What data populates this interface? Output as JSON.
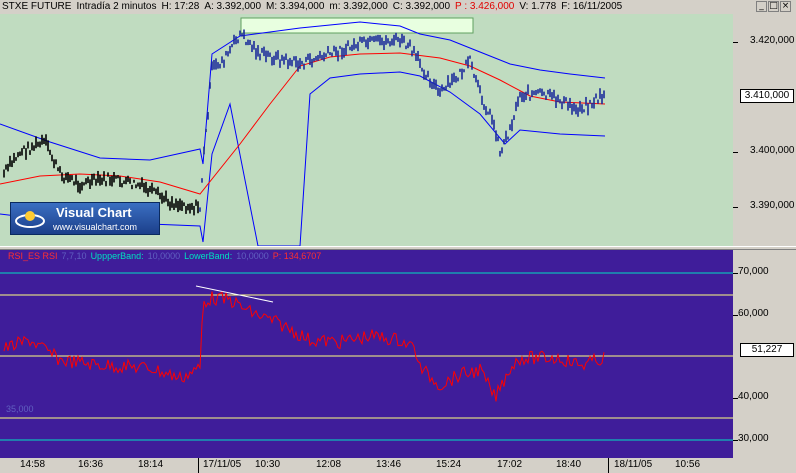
{
  "title_bar": {
    "symbol": "STXE FUTURE",
    "interval": "Intradía 2 minutos",
    "high": "H: 17:28",
    "ask": "A: 3.392,000",
    "max": "M: 3.394,000",
    "min": "m: 3.392,000",
    "close": "C: 3.392,000",
    "price": "P : 3.426,000",
    "volume": "V: 1.778",
    "date": "F: 16/11/2005",
    "min_btn": "_",
    "max_btn": "□",
    "close_btn": "×"
  },
  "price_axis": {
    "ticks": [
      "3.420,000",
      "3.410,000",
      "3.400,000",
      "3.390,000"
    ],
    "current": "3.410,000"
  },
  "logo": {
    "name": "Visual Chart",
    "url": "www.visualchart.com"
  },
  "rsi_header": {
    "name": "RSI_ES  RSI",
    "params": "7,7,10",
    "upper_label": "UppperBand:",
    "upper_value": "10,0000",
    "lower_label": "LowerBand:",
    "lower_value": "10,0000",
    "p_value": "P: 134,6707",
    "side_label": "35,000",
    "min_btn": "_",
    "max_btn": "□",
    "close_btn": "×"
  },
  "rsi_axis": {
    "ticks": [
      "70,000",
      "60,000",
      "40,000",
      "30,000"
    ],
    "current": "51,227"
  },
  "time_axis": {
    "labels": [
      "14:58",
      "16:36",
      "18:14",
      "17/11/05",
      "10:30",
      "12:08",
      "13:46",
      "15:24",
      "17:02",
      "18:40",
      "18/11/05",
      "10:56"
    ]
  },
  "colors": {
    "price_bg": "#c0dcc0",
    "rsi_bg": "#3f1d9a",
    "bands": "#0000ff",
    "ma": "#ff0000",
    "rsi_line": "#ff0000",
    "rsi_band_yellow": "#ffff80",
    "rsi_band_cyan": "#00e0c0",
    "price_black": "#000000",
    "price_blue": "#1a2a9a"
  }
}
